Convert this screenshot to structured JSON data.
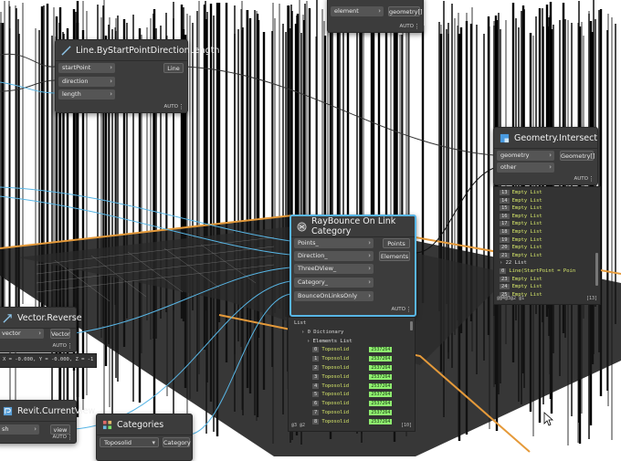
{
  "nodes": {
    "geometry_top": {
      "inputs": [
        "element"
      ],
      "outputs": [
        "geometry[]"
      ],
      "lacing": "AUTO"
    },
    "line_by_start": {
      "title": "Line.ByStartPointDirectionLength",
      "inputs": [
        "startPoint",
        "direction",
        "length"
      ],
      "outputs": [
        "Line"
      ],
      "lacing": "AUTO"
    },
    "geometry_intersect": {
      "title": "Geometry.Intersect",
      "inputs": [
        "geometry",
        "other"
      ],
      "outputs": [
        "Geometry[]"
      ],
      "lacing": "AUTO"
    },
    "raybounce": {
      "title": "RayBounce On Link Category",
      "inputs": [
        "Points_",
        "Direction_",
        "ThreeDView_",
        "Category_",
        "BounceOnLinksOnly"
      ],
      "outputs": [
        "Points",
        "Elements"
      ],
      "lacing": "AUTO"
    },
    "vector_reverse": {
      "title": "Vector.Reverse",
      "inputs": [
        "vector"
      ],
      "outputs": [
        "Vector"
      ],
      "lacing": "AUTO",
      "preview": "X = -0.000, Y = -0.000, Z = -1"
    },
    "revit_current_view": {
      "title": "Revit.CurrentView",
      "inputs": [
        "sh"
      ],
      "outputs": [
        "view"
      ],
      "lacing": "AUTO"
    },
    "categories": {
      "title": "Categories",
      "selected": "Toposolid",
      "outputs": [
        "Category"
      ]
    }
  },
  "intersect_preview": {
    "items": [
      "Empty List",
      "Empty List",
      "Empty List",
      "Empty List",
      "Empty List",
      "Empty List",
      "Empty List",
      "Empty List",
      "Empty List"
    ],
    "sublist_label": "22 List",
    "line_item": "Line(StartPoint = Poin",
    "tail_items": [
      "Empty List",
      "Empty List",
      "Empty List"
    ],
    "footer_left": "@@4@3@2 @1",
    "footer_right": "[13]"
  },
  "raybounce_preview": {
    "header": "List",
    "dict_label": "0 Dictionary",
    "elements_label": "Elements List",
    "rows": [
      {
        "idx": "0",
        "name": "Toposolid",
        "id": "2537264"
      },
      {
        "idx": "1",
        "name": "Toposolid",
        "id": "2537264"
      },
      {
        "idx": "2",
        "name": "Toposolid",
        "id": "2537264"
      },
      {
        "idx": "3",
        "name": "Toposolid",
        "id": "2537264"
      },
      {
        "idx": "4",
        "name": "Toposolid",
        "id": "2537264"
      },
      {
        "idx": "5",
        "name": "Toposolid",
        "id": "2537264"
      },
      {
        "idx": "6",
        "name": "Toposolid",
        "id": "2537264"
      },
      {
        "idx": "7",
        "name": "Toposolid",
        "id": "2537264"
      },
      {
        "idx": "8",
        "name": "Toposolid",
        "id": "2537264"
      }
    ],
    "footer_left": "@3 @2",
    "footer_right": "[10]"
  },
  "colors": {
    "node_bg": "#3c3c3c",
    "selected_border": "#58b6e6",
    "wire": "#58b6e6",
    "element_id": "#8ff06f",
    "preview_value": "#d6e76a",
    "ground_edge": "#e59a3a"
  },
  "icons": [
    "dynamo-node-icon",
    "custom-node-icon",
    "list-item-icon",
    "cursor-icon"
  ]
}
